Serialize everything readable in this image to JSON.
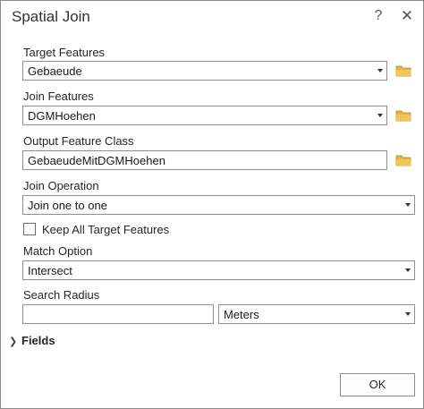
{
  "dialog": {
    "title": "Spatial Join",
    "help_glyph": "?",
    "close_glyph": "✕"
  },
  "target_features": {
    "label": "Target Features",
    "value": "Gebaeude"
  },
  "join_features": {
    "label": "Join Features",
    "value": "DGMHoehen"
  },
  "output_feature_class": {
    "label": "Output Feature Class",
    "value": "GebaeudeMitDGMHoehen"
  },
  "join_operation": {
    "label": "Join Operation",
    "value": "Join one to one"
  },
  "keep_all": {
    "label": "Keep All Target Features",
    "checked": false
  },
  "match_option": {
    "label": "Match Option",
    "value": "Intersect"
  },
  "search_radius": {
    "label": "Search Radius",
    "value": "",
    "unit": "Meters"
  },
  "fields": {
    "label": "Fields",
    "chevron": "❯"
  },
  "ok_button": {
    "label": "OK"
  },
  "icons": {
    "folder": "folder-icon",
    "dropdown": "chevron-down-icon"
  },
  "colors": {
    "folder": "#e8b43a",
    "border": "#8f8f8f"
  }
}
